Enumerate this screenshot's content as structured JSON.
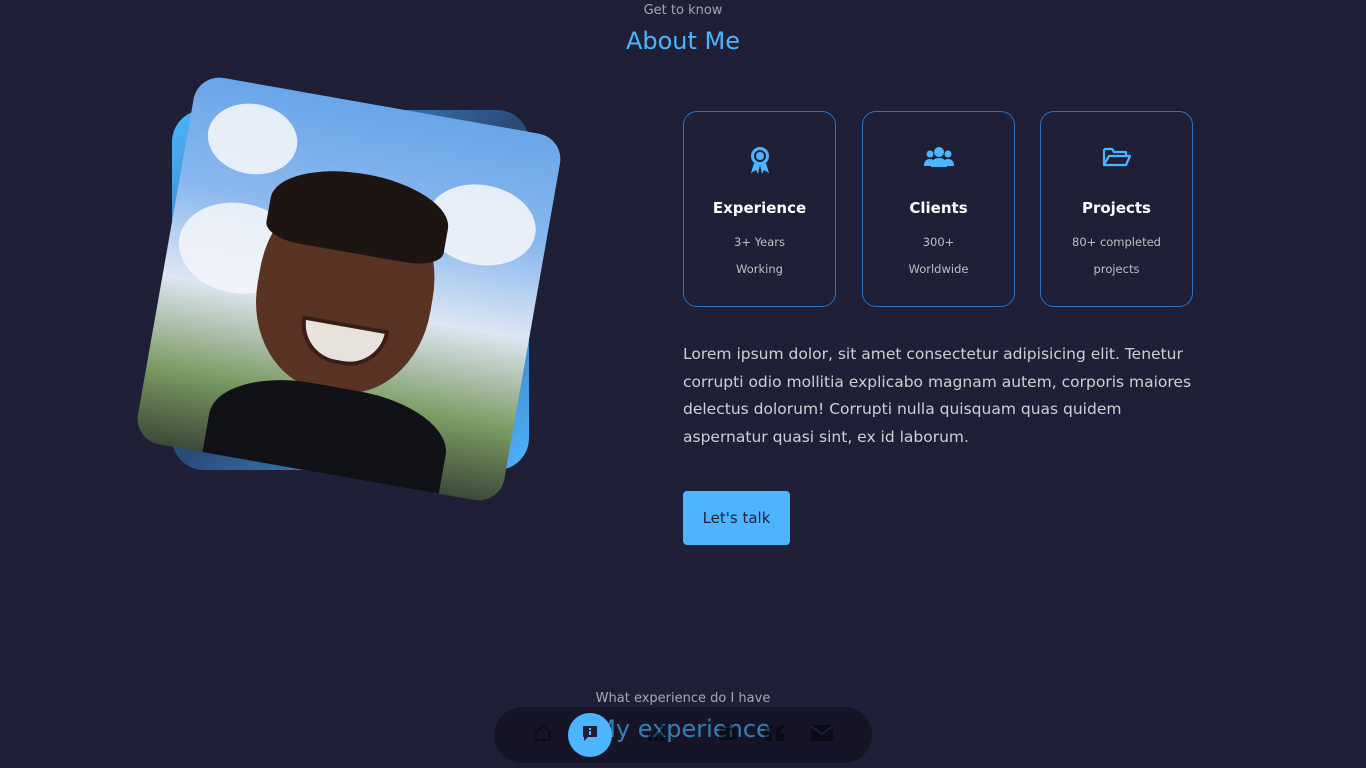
{
  "about": {
    "eyebrow": "Get to know",
    "title": "About Me"
  },
  "cards": [
    {
      "icon": "award-icon",
      "title": "Experience",
      "line1": "3+ Years",
      "line2": "Working"
    },
    {
      "icon": "users-icon",
      "title": "Clients",
      "line1": "300+",
      "line2": "Worldwide"
    },
    {
      "icon": "folder-open-icon",
      "title": "Projects",
      "line1": "80+ completed",
      "line2": "projects"
    }
  ],
  "description": "Lorem ipsum dolor, sit amet consectetur adipisicing elit. Tenetur corrupti odio mollitia explicabo magnam autem, corporis maiores delectus dolorum! Corrupti nulla quisquam quas quidem aspernatur quasi sint, ex id laborum.",
  "cta_label": "Let's talk",
  "experience": {
    "eyebrow": "What experience do I have",
    "title": "My experience"
  },
  "nav": {
    "items": [
      "home-icon",
      "about-icon",
      "experience-icon",
      "services-icon",
      "testimonials-icon",
      "mail-icon"
    ],
    "active": "about-icon"
  },
  "colors": {
    "background": "#1f1f38",
    "accent": "#4db5ff",
    "card_border": "#2c72c2"
  }
}
